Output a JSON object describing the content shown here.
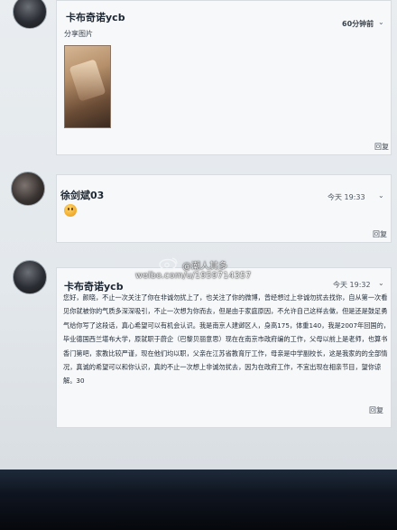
{
  "posts": [
    {
      "author": "卡布奇诺ycb",
      "time": "60分钟前",
      "share_label": "分享图片",
      "reply": "回复"
    },
    {
      "author": "徐剑斌03",
      "time": "今天 19:33",
      "reply": "回复"
    },
    {
      "author": "卡布奇诺ycb",
      "time": "今天 19:32",
      "text": "您好，颜晓，不止一次关注了你在非诚勿扰上了，也关注了你的微博，曾经想过上非诚勿扰去找你，自从第一次看见你就被你的气质多深深吸引，不止一次想为你而去，但是由于家庭原因，不允许自己这样去做，但是还是鼓足勇气给你写了这段话，真心希望可以有机会认识。我是南京人建邺区人，身高175，体重140，我是2007年回国的，毕业德国西兰堪布大学，原就职于蔚企（巴黎贝丽意思）现在在南京市政府编的工作，父母以前上是老师，也算书香门第吧，家教比较严谨，现在他们均以职，父亲在江苏省教育厅工作，母亲是中学副校长，这是我家的的全部情况，真诚的希望可以和你认识，真的不止一次想上非诚勿扰去，因为在政府工作，不宜出现在相亲节目，望你谅解。30",
      "reply": "回复"
    }
  ],
  "watermark": {
    "handle": "@潮人其多",
    "url": "weibo.com/u/1959714357"
  },
  "colors": {
    "screen_bg": "#e6eaee",
    "card_bg": "#f7f8f9",
    "text": "#1f2a36"
  }
}
